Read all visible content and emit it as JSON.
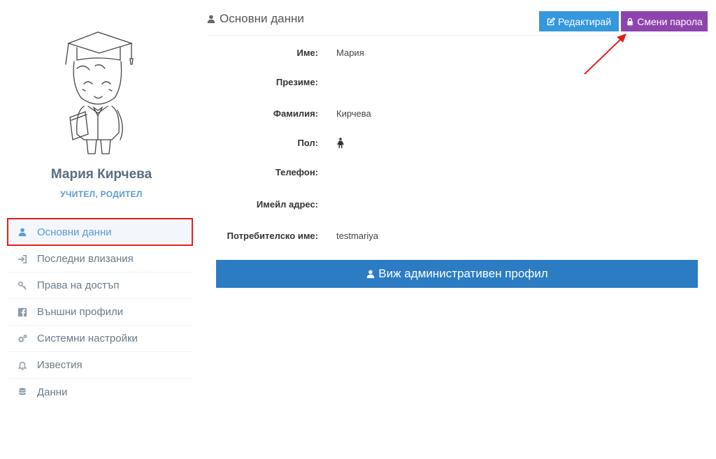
{
  "profile": {
    "name": "Мария Кирчева",
    "roles": "УЧИТЕЛ, РОДИТЕЛ"
  },
  "sidebar": {
    "items": [
      {
        "label": "Основни данни",
        "icon": "user-icon",
        "active": true
      },
      {
        "label": "Последни влизания",
        "icon": "sign-in-icon"
      },
      {
        "label": "Права на достъп",
        "icon": "key-icon"
      },
      {
        "label": "Външни профили",
        "icon": "facebook-icon"
      },
      {
        "label": "Системни настройки",
        "icon": "cogs-icon"
      },
      {
        "label": "Известия",
        "icon": "bell-icon"
      },
      {
        "label": "Данни",
        "icon": "database-icon"
      }
    ]
  },
  "main": {
    "caption": "Основни данни",
    "edit_label": "Редактирай",
    "change_password_label": "Смени парола",
    "fields": [
      {
        "label": "Име:",
        "value": "Мария"
      },
      {
        "label": "Презиме:",
        "value": ""
      },
      {
        "label": "Фамилия:",
        "value": "Кирчева"
      },
      {
        "label": "Пол:",
        "value": "",
        "icon": "female-icon"
      },
      {
        "label": "Телефон:",
        "value": ""
      },
      {
        "label": "Имейл адрес:",
        "value": ""
      },
      {
        "label": "Потребителско име:",
        "value": "testmariya"
      }
    ],
    "admin_profile_label": "Виж административен профил"
  },
  "colors": {
    "edit_button": "#3598dc",
    "password_button": "#8e44ad",
    "admin_button": "#2b7cc2",
    "highlight": "#e41e1e"
  }
}
